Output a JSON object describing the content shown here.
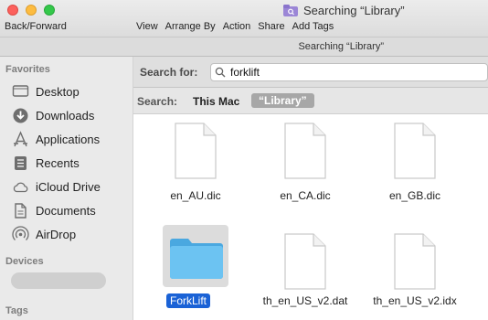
{
  "window": {
    "title": "Searching “Library”",
    "back_forward": "Back/Forward",
    "toolbar": {
      "view": "View",
      "arrange_by": "Arrange By",
      "action": "Action",
      "share": "Share",
      "add_tags": "Add Tags"
    },
    "path_title": "Searching “Library”"
  },
  "sidebar": {
    "favorites_heading": "Favorites",
    "items": [
      {
        "label": "Desktop",
        "icon": "desktop-icon"
      },
      {
        "label": "Downloads",
        "icon": "downloads-icon"
      },
      {
        "label": "Applications",
        "icon": "applications-icon"
      },
      {
        "label": "Recents",
        "icon": "recents-icon"
      },
      {
        "label": "iCloud Drive",
        "icon": "cloud-icon"
      },
      {
        "label": "Documents",
        "icon": "documents-icon"
      },
      {
        "label": "AirDrop",
        "icon": "airdrop-icon"
      }
    ],
    "devices_heading": "Devices",
    "tags_heading": "Tags"
  },
  "search": {
    "label": "Search for:",
    "query": "forklift",
    "scope_label": "Search:",
    "scope_this_mac": "This Mac",
    "scope_library": "“Library”"
  },
  "files": [
    {
      "name": "en_AU.dic",
      "type": "document"
    },
    {
      "name": "en_CA.dic",
      "type": "document"
    },
    {
      "name": "en_GB.dic",
      "type": "document"
    },
    {
      "name": "ForkLift",
      "type": "folder",
      "selected": true
    },
    {
      "name": "th_en_US_v2.dat",
      "type": "document"
    },
    {
      "name": "th_en_US_v2.idx",
      "type": "document"
    }
  ],
  "colors": {
    "selection": "#1a62d6",
    "folder": "#5ab9ee",
    "scope_pill": "#a7a7a7"
  }
}
